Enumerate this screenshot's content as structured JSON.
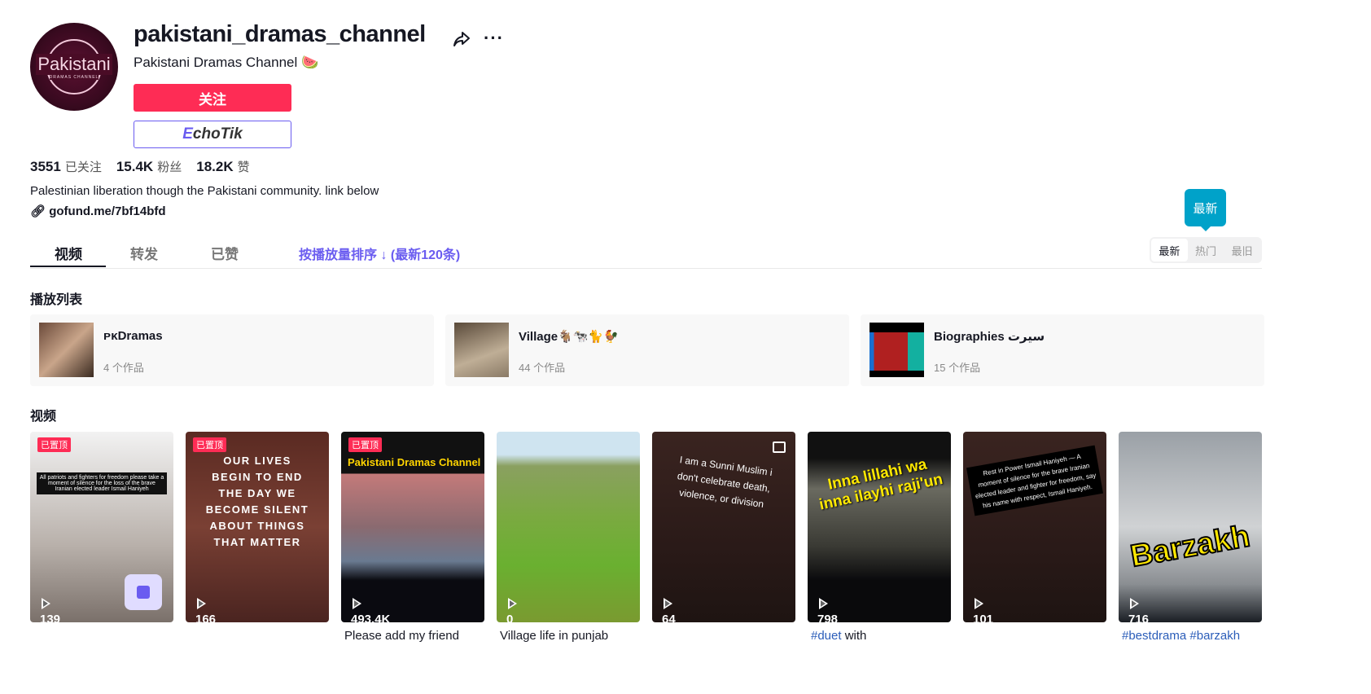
{
  "profile": {
    "avatar_text": "Pakistani",
    "avatar_sub": "DRAMAS CHANNEL",
    "username": "pakistani_dramas_channel",
    "nickname": "Pakistani Dramas Channel 🍉",
    "follow_label": "关注",
    "echotik_e": "E",
    "echotik_rest": "choTik",
    "bio": "Palestinian liberation though the Pakistani community. link below",
    "link": "gofund.me/7bf14bfd"
  },
  "stats": [
    {
      "value": "3551",
      "label": "已关注"
    },
    {
      "value": "15.4K",
      "label": "粉丝"
    },
    {
      "value": "18.2K",
      "label": "赞"
    }
  ],
  "tabs": [
    {
      "label": "视频"
    },
    {
      "label": "转发"
    },
    {
      "label": "已赞"
    }
  ],
  "sort_link": "按播放量排序 ↓ (最新120条)",
  "sort_tooltip": "最新",
  "sort_options": [
    {
      "label": "最新",
      "selected": true
    },
    {
      "label": "热门"
    },
    {
      "label": "最旧"
    }
  ],
  "playlists_title": "播放列表",
  "playlists": [
    {
      "name": "ᴘᴋDramas",
      "count": "4 个作品"
    },
    {
      "name": "Village🐐🐄🐈🐓",
      "count": "44 个作品"
    },
    {
      "name": "Biographies سیرت",
      "count": "15 个作品"
    }
  ],
  "videos_title": "视频",
  "pinned_label": "已置顶",
  "videos": [
    {
      "views": "139",
      "pinned": true,
      "overlay": "All patriots and fighters for freedom please take a moment of silence for the loss of the brave Iranian elected leader Ismail Haniyeh",
      "caption": ""
    },
    {
      "views": "166",
      "pinned": true,
      "overlay": "OUR LIVES BEGIN TO END THE DAY WE BECOME SILENT ABOUT THINGS THAT MATTER",
      "caption": ""
    },
    {
      "views": "493.4K",
      "pinned": true,
      "overlay": "Pakistani Dramas Channel",
      "caption": "Please add my friend"
    },
    {
      "views": "0",
      "overlay": "",
      "caption": "Village life in punjab"
    },
    {
      "views": "64",
      "overlay": "I am a Sunni Muslim  i don't celebrate death, violence, or division",
      "caption": ""
    },
    {
      "views": "798",
      "overlay": "Inna lillahi wa inna ilayhi raji'un",
      "caption_tag": "#duet",
      "caption": " with"
    },
    {
      "views": "101",
      "overlay": "Rest in Power Ismail Haniyeh — A moment of silence for the brave Iranian elected leader and fighter for freedom, say his name with respect, Ismail Haniyeh.",
      "caption": ""
    },
    {
      "views": "716",
      "overlay": "Barzakh",
      "caption_tag": "#bestdrama #barzakh",
      "caption": ""
    }
  ],
  "colors": {
    "brand": "#fe2c55",
    "accent": "#6a5cf0",
    "tooltip": "#00a2c9"
  }
}
